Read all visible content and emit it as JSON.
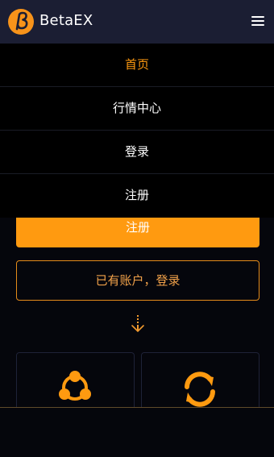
{
  "header": {
    "brand": "BetaEX",
    "logo_icon": "betaex-logo-icon",
    "menu_icon": "hamburger-menu-icon"
  },
  "nav": {
    "items": [
      {
        "label": "首页",
        "active": true
      },
      {
        "label": "行情中心",
        "active": false
      },
      {
        "label": "登录",
        "active": false
      },
      {
        "label": "注册",
        "active": false
      }
    ]
  },
  "main": {
    "register_button": "注册",
    "login_button": "已有账户，登录",
    "scroll_icon": "scroll-down-arrow-icon",
    "cards": [
      {
        "icon": "share-network-icon"
      },
      {
        "icon": "exchange-refresh-icon"
      }
    ]
  },
  "colors": {
    "accent": "#ff9a10",
    "header_bg": "#1b1e33",
    "page_bg": "#05060c"
  }
}
